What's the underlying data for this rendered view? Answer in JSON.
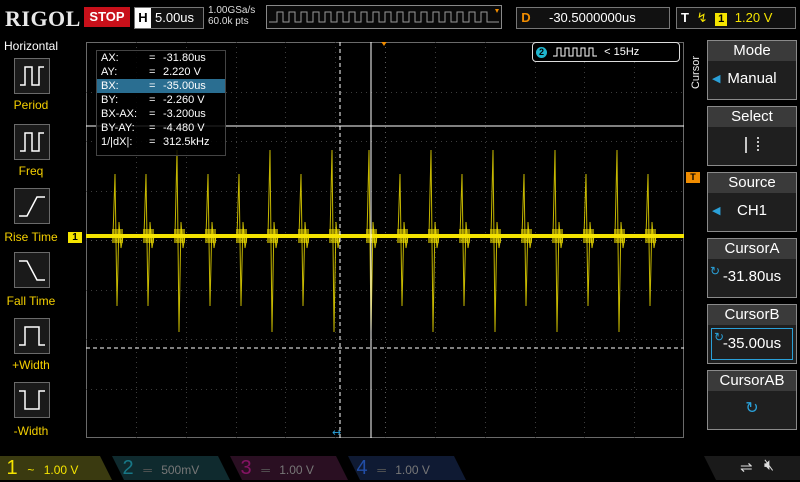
{
  "topbar": {
    "logo": "RIGOL",
    "run_state": "STOP",
    "horizontal_label": "H",
    "timebase": "5.00us",
    "sample_rate": "1.00GSa/s",
    "memory_depth": "60.0k pts",
    "delay_label": "D",
    "delay": "-30.5000000us",
    "trigger_label": "T",
    "trigger_channel": "1",
    "trigger_level": "1.20 V"
  },
  "left_panel": {
    "title": "Horizontal",
    "items": [
      {
        "label": "Period"
      },
      {
        "label": "Freq"
      },
      {
        "label": "Rise Time"
      },
      {
        "label": "Fall Time"
      },
      {
        "label": "+Width"
      },
      {
        "label": "-Width"
      }
    ]
  },
  "measurements": {
    "rows": [
      {
        "key": "AX:",
        "eq": "=",
        "value": "-31.80us"
      },
      {
        "key": "AY:",
        "eq": "=",
        "value": "2.220 V"
      },
      {
        "key": "BX:",
        "eq": "=",
        "value": "-35.00us"
      },
      {
        "key": "BY:",
        "eq": "=",
        "value": "-2.260 V"
      },
      {
        "key": "BX-AX:",
        "eq": "=",
        "value": "-3.200us"
      },
      {
        "key": "BY-AY:",
        "eq": "=",
        "value": "-4.480 V"
      },
      {
        "key": "1/|dX|:",
        "eq": "=",
        "value": "312.5kHz"
      }
    ],
    "selected_row": 2
  },
  "trigger_freq": {
    "channel": "2",
    "text": "< 15Hz"
  },
  "markers": {
    "ch1_marker": "1",
    "trigger_marker": "T"
  },
  "right_menu": {
    "vertical_title": "Cursor",
    "items": [
      {
        "header": "Mode",
        "value": "Manual"
      },
      {
        "header": "Select",
        "value": ""
      },
      {
        "header": "Source",
        "value": "CH1"
      },
      {
        "header": "CursorA",
        "value": "-31.80us"
      },
      {
        "header": "CursorB",
        "value": "-35.00us"
      },
      {
        "header": "CursorAB",
        "value": ""
      }
    ]
  },
  "bottombar": {
    "channels": [
      {
        "num": "1",
        "scale": "1.00 V",
        "color": "#f5e400"
      },
      {
        "num": "2",
        "scale": "500mV",
        "color": "#1fb6cf"
      },
      {
        "num": "3",
        "scale": "1.00 V",
        "color": "#d0189a"
      },
      {
        "num": "4",
        "scale": "1.00 V",
        "color": "#2a63d6"
      }
    ]
  },
  "colors": {
    "ch1": "#f5e400",
    "accent_orange": "#f08c00",
    "stop_red": "#c8101a",
    "selection_blue": "#2a6e91"
  }
}
